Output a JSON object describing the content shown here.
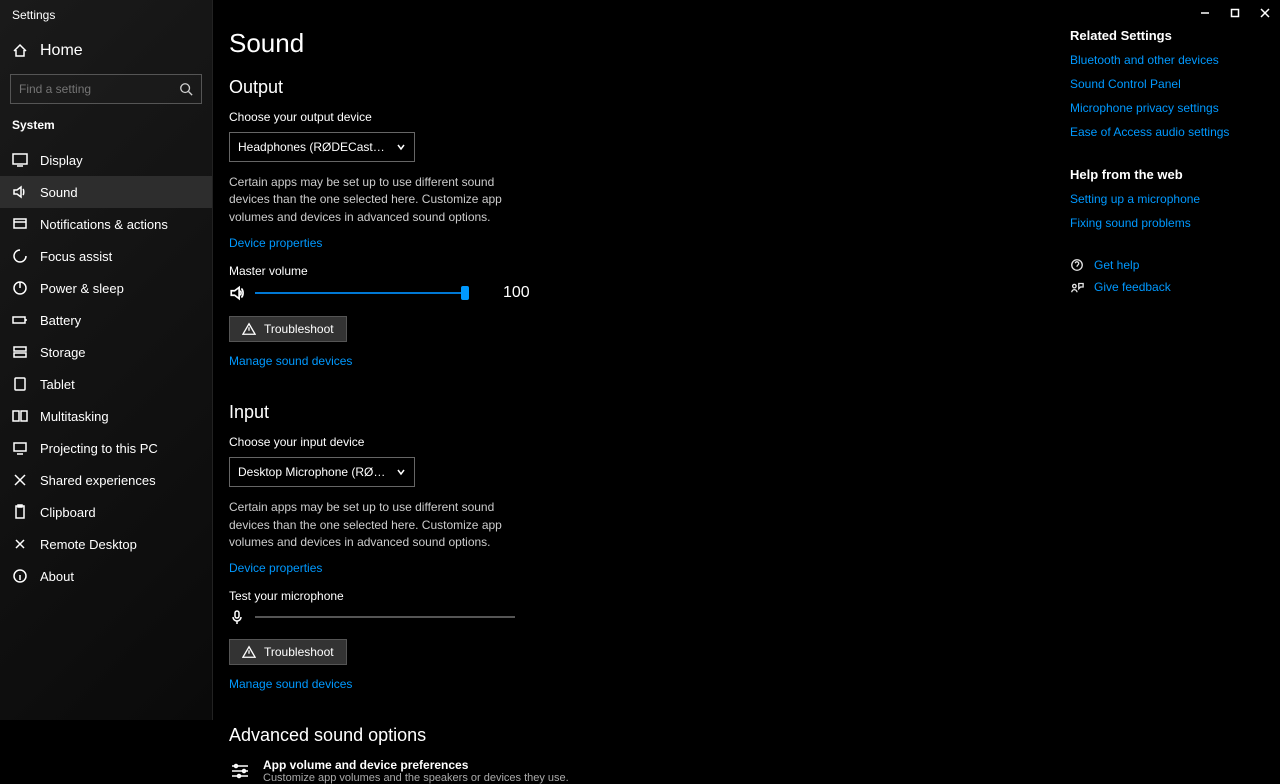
{
  "window": {
    "title": "Settings"
  },
  "sidebar": {
    "home": "Home",
    "search_placeholder": "Find a setting",
    "group": "System",
    "items": [
      {
        "label": "Display"
      },
      {
        "label": "Sound"
      },
      {
        "label": "Notifications & actions"
      },
      {
        "label": "Focus assist"
      },
      {
        "label": "Power & sleep"
      },
      {
        "label": "Battery"
      },
      {
        "label": "Storage"
      },
      {
        "label": "Tablet"
      },
      {
        "label": "Multitasking"
      },
      {
        "label": "Projecting to this PC"
      },
      {
        "label": "Shared experiences"
      },
      {
        "label": "Clipboard"
      },
      {
        "label": "Remote Desktop"
      },
      {
        "label": "About"
      }
    ]
  },
  "page": {
    "title": "Sound",
    "output": {
      "heading": "Output",
      "choose_label": "Choose your output device",
      "device": "Headphones (RØDECaster Pro II Sec...",
      "desc": "Certain apps may be set up to use different sound devices than the one selected here. Customize app volumes and devices in advanced sound options.",
      "device_props": "Device properties",
      "master_label": "Master volume",
      "master_value": "100",
      "troubleshoot": "Troubleshoot",
      "manage": "Manage sound devices"
    },
    "input": {
      "heading": "Input",
      "choose_label": "Choose your input device",
      "device": "Desktop Microphone (RØDECaster P...",
      "desc": "Certain apps may be set up to use different sound devices than the one selected here. Customize app volumes and devices in advanced sound options.",
      "device_props": "Device properties",
      "test_label": "Test your microphone",
      "troubleshoot": "Troubleshoot",
      "manage": "Manage sound devices"
    },
    "advanced": {
      "heading": "Advanced sound options",
      "pref_title": "App volume and device preferences",
      "pref_sub": "Customize app volumes and the speakers or devices they use."
    }
  },
  "right": {
    "related_h": "Related Settings",
    "related": [
      "Bluetooth and other devices",
      "Sound Control Panel",
      "Microphone privacy settings",
      "Ease of Access audio settings"
    ],
    "help_h": "Help from the web",
    "help": [
      "Setting up a microphone",
      "Fixing sound problems"
    ],
    "get_help": "Get help",
    "feedback": "Give feedback"
  }
}
